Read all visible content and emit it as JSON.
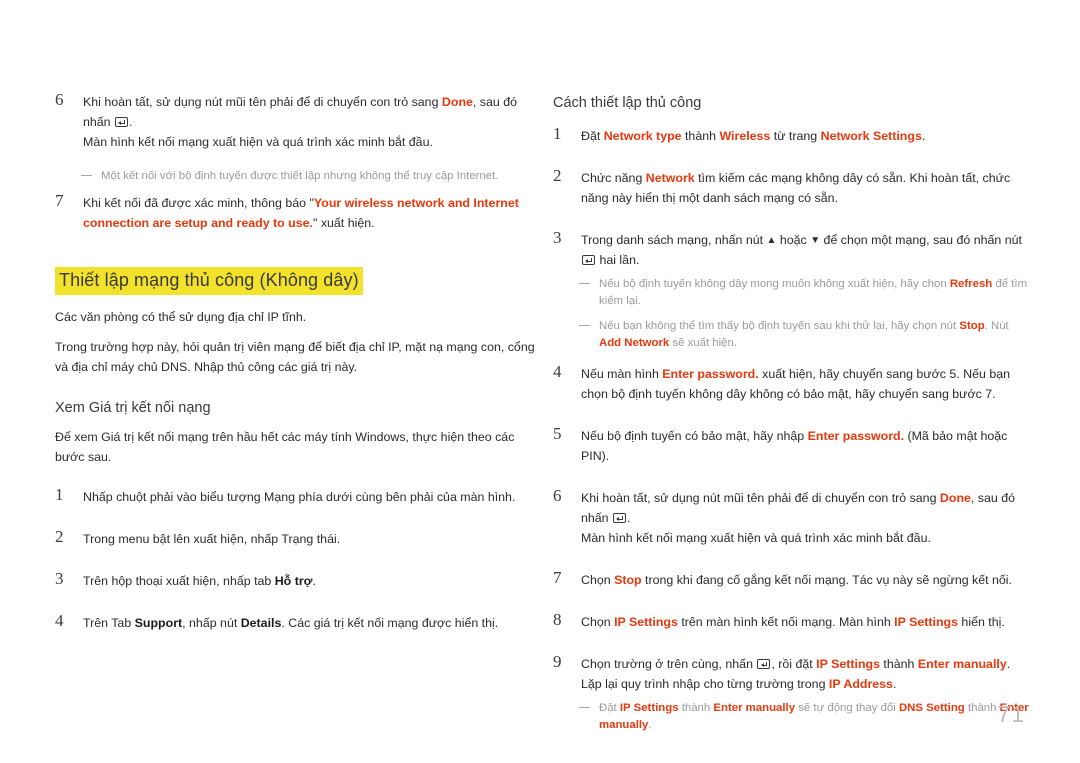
{
  "page": {
    "number": "71"
  },
  "left_column": {
    "step6": {
      "num": "6",
      "line1_a": "Khi hoàn tất, sử dụng nút mũi tên phải để di chuyển con trỏ sang ",
      "line1_done": "Done",
      "line1_b": ", sau đó nhấn ",
      "line1_c": ".",
      "line2": "Màn hình kết nối mạng xuất hiện và quá trình xác minh bắt đầu."
    },
    "note1": "Một kết nối với bộ định tuyến được thiết lập nhưng không thể truy cập Internet.",
    "step7": {
      "num": "7",
      "a": "Khi kết nối đã được xác minh, thông báo \"",
      "red": "Your wireless network and Internet connection are setup and ready to use.",
      "b": "\" xuất hiện."
    },
    "heading_highlight": "Thiết lập mạng thủ công (Không dây)",
    "para1": "Các văn phòng có thể sử dụng địa chỉ IP tĩnh.",
    "para2": "Trong trường hợp này, hỏi quản trị viên mạng để biết địa chỉ IP, mặt nạ mạng con, cổng và địa chỉ máy chủ DNS. Nhập thủ công các giá trị này.",
    "heading_sub": "Xem Giá trị kết nối nạng",
    "para3": "Để xem Giá trị kết nối mạng trên hầu hết các máy tính Windows, thực hiện theo các bước sau.",
    "steps": [
      {
        "num": "1",
        "text": "Nhấp chuột phải vào biểu tượng Mạng phía dưới cùng bên phải của màn hình."
      },
      {
        "num": "2",
        "text": "Trong menu bật lên xuất hiện, nhấp Trạng thái."
      },
      {
        "num": "3",
        "a": "Trên hộp thoại xuất hiện, nhấp tab ",
        "bold": "Hỗ trợ",
        "b": "."
      },
      {
        "num": "4",
        "a": "Trên Tab ",
        "bold1": "Support",
        "b": ", nhấp nút ",
        "bold2": "Details",
        "c": ". Các giá trị kết nối mạng được hiển thị."
      }
    ]
  },
  "right_column": {
    "heading": "Cách thiết lập thủ công",
    "step1": {
      "num": "1",
      "a": "Đặt ",
      "red1": "Network type",
      "b": " thành ",
      "red2": "Wireless",
      "c": " từ trang ",
      "red3": "Network Settings",
      "d": "."
    },
    "step2": {
      "num": "2",
      "a": "Chức năng ",
      "red": "Network",
      "b": " tìm kiếm các mạng không dây có sẵn. Khi hoàn tất, chức năng này hiển thị một danh sách mạng có sẵn."
    },
    "step3": {
      "num": "3",
      "a": "Trong danh sách mạng, nhấn nút ",
      "up": "▲",
      "b": " hoặc ",
      "down": "▼",
      "c": " để chọn một mạng, sau đó nhấn nút ",
      "d": " hai lần."
    },
    "note1": {
      "a": "Nếu bộ định tuyến không dây mong muốn không xuất hiện, hãy chọn ",
      "red": "Refresh",
      "b": " để tìm kiếm lại."
    },
    "note2": {
      "a": "Nếu bạn không thể tìm thấy bộ định tuyến sau khi thử lại, hãy chọn nút ",
      "red1": "Stop",
      "b": ". Nút ",
      "red2": "Add Network",
      "c": " sẽ xuất hiện."
    },
    "step4": {
      "num": "4",
      "a": "Nếu màn hình ",
      "red": "Enter password.",
      "b": " xuất hiện, hãy chuyển sang bước 5. Nếu bạn chọn bộ định tuyến không dây không có bảo mật, hãy chuyển sang bước 7."
    },
    "step5": {
      "num": "5",
      "a": "Nếu bộ định tuyến có bảo mật, hãy nhập ",
      "red": "Enter password.",
      "b": " (Mã bảo mật hoặc PIN)."
    },
    "step6": {
      "num": "6",
      "a": "Khi hoàn tất, sử dụng nút mũi tên phải để di chuyển con trỏ sang ",
      "red": "Done",
      "b": ", sau đó nhấn ",
      "c": ".",
      "line2": "Màn hình kết nối mạng xuất hiện và quá trình xác minh bắt đầu."
    },
    "step7": {
      "num": "7",
      "a": "Chọn ",
      "red": "Stop",
      "b": " trong khi đang cố gắng kết nối mạng. Tác vụ này sẽ ngừng kết nối."
    },
    "step8": {
      "num": "8",
      "a": "Chọn ",
      "red1": "IP Settings",
      "b": " trên màn hình kết nối mạng. Màn hình ",
      "red2": "IP Settings",
      "c": " hiển thị."
    },
    "step9": {
      "num": "9",
      "a": "Chọn trường ở trên cùng, nhấn ",
      "b": ", rồi đặt ",
      "red1": "IP Settings",
      "c": " thành ",
      "red2": "Enter manually",
      "d": ". Lặp lại quy trình nhập cho từng trường trong ",
      "red3": "IP Address",
      "e": "."
    },
    "note3": {
      "a": "Đặt ",
      "red1": "IP Settings",
      "b": " thành ",
      "red2": "Enter manually",
      "c": " sẽ tự động thay đổi ",
      "red3": "DNS Setting",
      "d": " thành ",
      "red4": "Enter manually",
      "e": "."
    }
  }
}
